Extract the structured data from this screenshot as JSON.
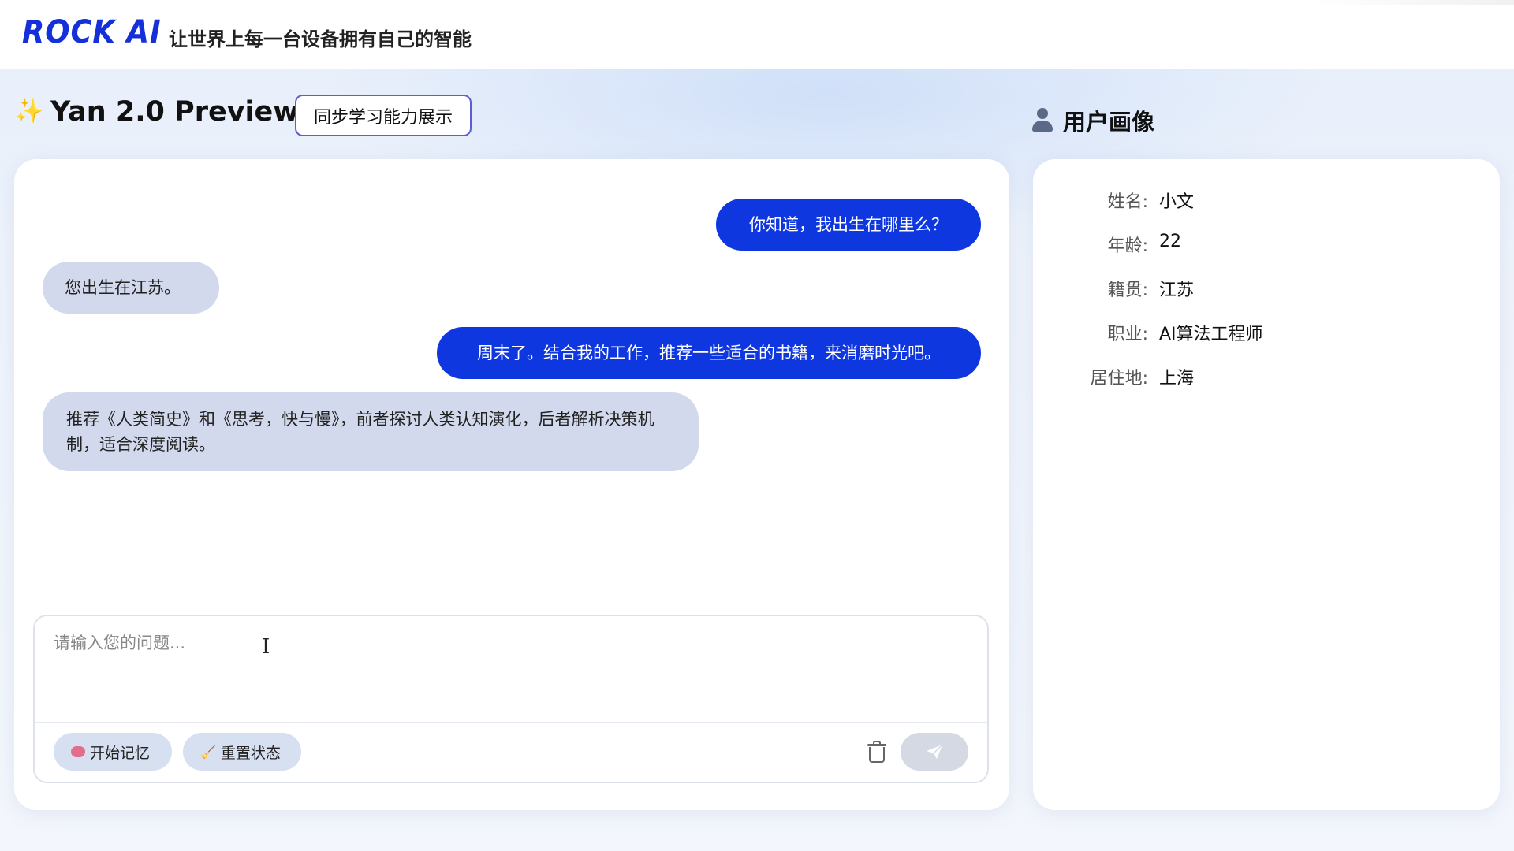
{
  "header": {
    "logo": "ROCK AI",
    "tagline": "让世界上每一台设备拥有自己的智能"
  },
  "titlebar": {
    "app_title": "Yan 2.0 Preview",
    "mode_button": "同步学习能力展示",
    "profile_title": "用户画像"
  },
  "chat": {
    "messages": [
      {
        "role": "user",
        "text": "你知道，我出生在哪里么？"
      },
      {
        "role": "assistant",
        "text": "您出生在江苏。"
      },
      {
        "role": "user",
        "text": "周末了。结合我的工作，推荐一些适合的书籍，来消磨时光吧。"
      },
      {
        "role": "assistant",
        "text": "推荐《人类简史》和《思考，快与慢》，前者探讨人类认知演化，后者解析决策机制，适合深度阅读。"
      }
    ],
    "input_placeholder": "请输入您的问题...",
    "memory_button": "开始记忆",
    "reset_button": "重置状态"
  },
  "profile": {
    "fields": [
      {
        "label": "姓名:",
        "value": "小文"
      },
      {
        "label": "年龄:",
        "value": "22"
      },
      {
        "label": "籍贯:",
        "value": "江苏"
      },
      {
        "label": "职业:",
        "value": "AI算法工程师"
      },
      {
        "label": "居住地:",
        "value": "上海"
      }
    ]
  },
  "colors": {
    "brand_blue": "#1530d8",
    "user_bubble": "#0f37e0",
    "assistant_bubble": "#d2d9ec",
    "chip_bg": "#d6e0f1",
    "send_disabled": "#d4d9e3"
  },
  "icons": [
    "sparkles-icon",
    "user-icon",
    "brain-icon",
    "broom-icon",
    "trash-icon",
    "send-icon"
  ]
}
